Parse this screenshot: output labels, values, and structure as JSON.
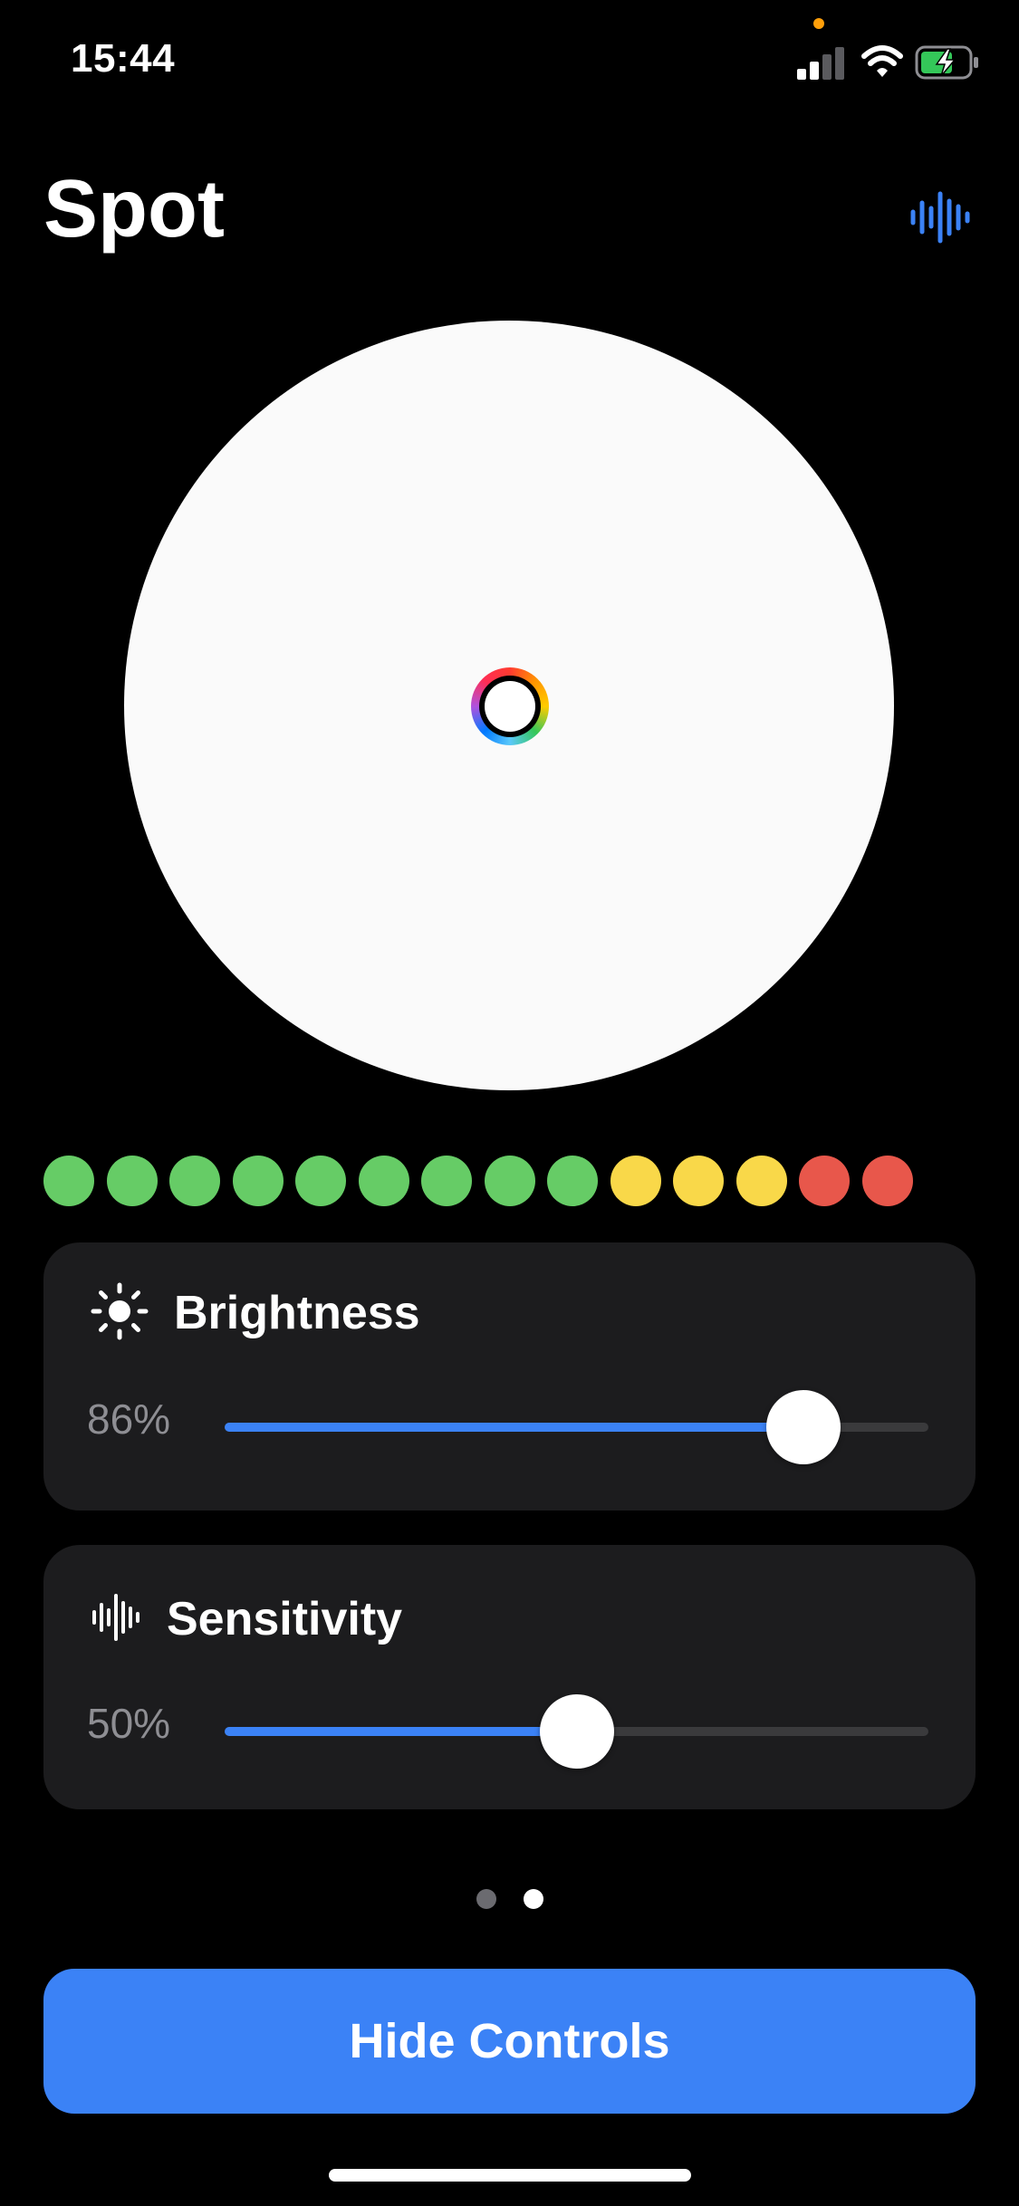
{
  "status_bar": {
    "time": "15:44",
    "signal_icon": "signal-icon",
    "wifi_icon": "wifi-icon",
    "battery_icon": "battery-charging-icon",
    "privacy_dot_color": "#ff9f0a"
  },
  "header": {
    "title": "Spot",
    "audio_button_icon": "waveform-icon",
    "accent_color": "#3b82f6"
  },
  "spot": {
    "circle_color": "#fafafa",
    "handle_icon": "color-picker-handle"
  },
  "level_meter": {
    "dots": [
      "#66cc66",
      "#66cc66",
      "#66cc66",
      "#66cc66",
      "#66cc66",
      "#66cc66",
      "#66cc66",
      "#66cc66",
      "#66cc66",
      "#f9d849",
      "#f9d849",
      "#f9d849",
      "#e8574b",
      "#e8574b"
    ]
  },
  "controls": {
    "brightness": {
      "icon": "sun-icon",
      "label": "Brightness",
      "value_text": "86%",
      "value": 0.86
    },
    "sensitivity": {
      "icon": "waveform-icon",
      "label": "Sensitivity",
      "value_text": "50%",
      "value": 0.5
    }
  },
  "pager": {
    "count": 2,
    "active_index": 1
  },
  "footer": {
    "hide_button_label": "Hide Controls"
  }
}
